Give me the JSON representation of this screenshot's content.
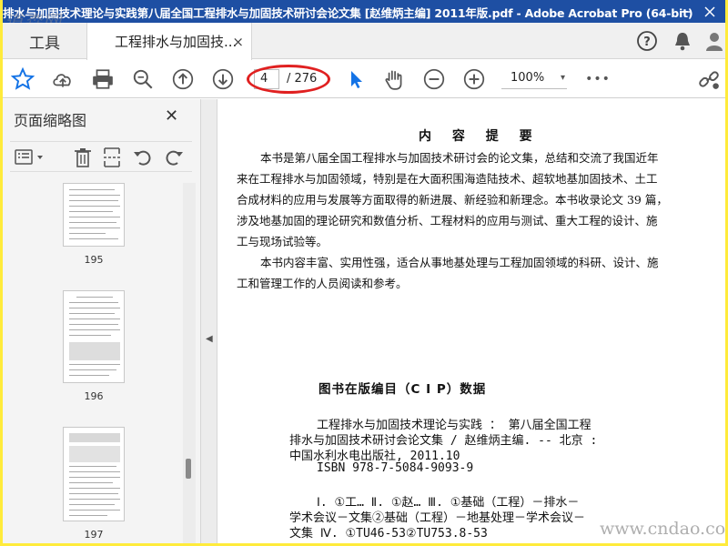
{
  "window": {
    "title": "排水与加固技术理论与实践第八届全国工程排水与加固技术研讨会论文集 [赵维炳主编] 2011年版.pdf - Adobe Acrobat Pro (64-bit)",
    "watermark_top": "道森网"
  },
  "tabs": {
    "tools": "工具",
    "doc": "工程排水与加固技...",
    "close": "×"
  },
  "toolbar": {
    "page_current": "4",
    "page_total": "/ 276",
    "zoom": "100%",
    "more": "•••"
  },
  "sidebar": {
    "title": "页面缩略图",
    "close": "✕",
    "thumbnails": [
      {
        "page": "195"
      },
      {
        "page": "196"
      },
      {
        "page": "197"
      }
    ]
  },
  "document": {
    "heading": "内 容 提 要",
    "paragraph1": [
      "本书是第八届全国工程排水与加固技术研讨会的论文集，总结和交流了我国近年",
      "来在工程排水与加固领域，特别是在大面积围海造陆技术、超软地基加固技术、土工",
      "合成材料的应用与发展等方面取得的新进展、新经验和新理念。本书收录论文 39 篇，",
      "涉及地基加固的理论研究和数值分析、工程材料的应用与测试、重大工程的设计、施",
      "工与现场试验等。"
    ],
    "paragraph2": [
      "本书内容丰富、实用性强，适合从事地基处理与工程加固领域的科研、设计、施",
      "工和管理工作的人员阅读和参考。"
    ],
    "cip_title": "图书在版编目（C I P）数据",
    "cip_lines": [
      "工程排水与加固技术理论与实践 ： 第八届全国工程",
      "排水与加固技术研讨会论文集 / 赵维炳主编. -- 北京 :",
      "中国水利水电出版社, 2011.10",
      "ISBN 978-7-5084-9093-9"
    ],
    "cip_class": [
      "Ⅰ. ①工… Ⅱ. ①赵… Ⅲ. ①基础（工程）－排水－",
      "学术会议－文集②基础（工程）－地基处理－学术会议－",
      "文集 Ⅳ. ①TU46-53②TU753.8-53"
    ],
    "watermark": "www.cndao.com"
  },
  "colors": {
    "titlebar": "#1e4fa3",
    "accent": "#1473e6",
    "highlight_ring": "#e02020",
    "frame": "#ffeb3b"
  }
}
